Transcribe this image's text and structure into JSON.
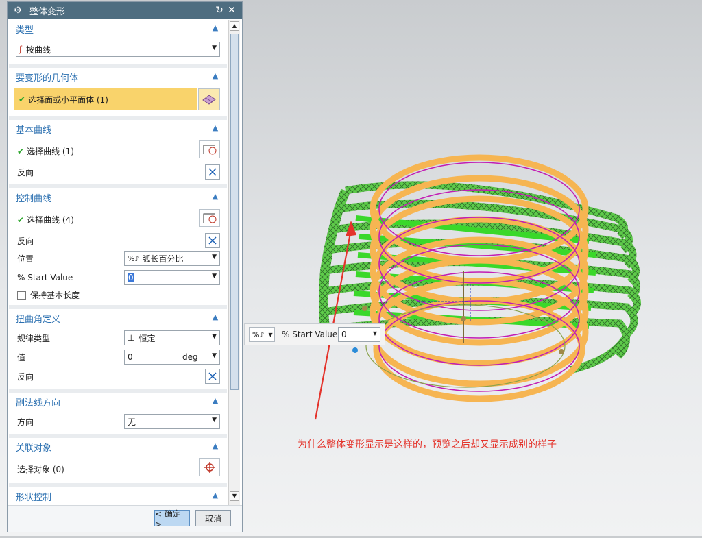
{
  "dialog": {
    "title": "整体变形",
    "sections": {
      "type": {
        "header": "类型",
        "selected": "按曲线"
      },
      "geometry": {
        "header": "要变形的几何体",
        "select_label": "选择面或小平面体 (1)"
      },
      "base_curve": {
        "header": "基本曲线",
        "select_label": "选择曲线 (1)",
        "reverse_label": "反向"
      },
      "control_curve": {
        "header": "控制曲线",
        "select_label": "选择曲线 (4)",
        "reverse_label": "反向",
        "position_label": "位置",
        "position_value": "弧长百分比",
        "start_label": "% Start Value",
        "start_value": "0",
        "keep_length_label": "保持基本长度"
      },
      "twist": {
        "header": "扭曲角定义",
        "law_label": "规律类型",
        "law_value": "恒定",
        "value_label": "值",
        "value": "0",
        "unit": "deg",
        "reverse_label": "反向"
      },
      "binormal": {
        "header": "副法线方向",
        "direction_label": "方向",
        "direction_value": "无"
      },
      "associate": {
        "header": "关联对象",
        "select_label": "选择对象 (0)"
      },
      "shape": {
        "header": "形状控制"
      }
    },
    "ok_label": "< 确定 >",
    "cancel_label": "取消"
  },
  "floatbar": {
    "label": "% Start Value",
    "value": "0"
  },
  "annotation": "为什么整体变形显示是这样的，预览之后却又显示成别的样子",
  "colors": {
    "accent": "#2a6fb0",
    "highlight": "#f9d36b",
    "annotation": "#e4332b"
  }
}
